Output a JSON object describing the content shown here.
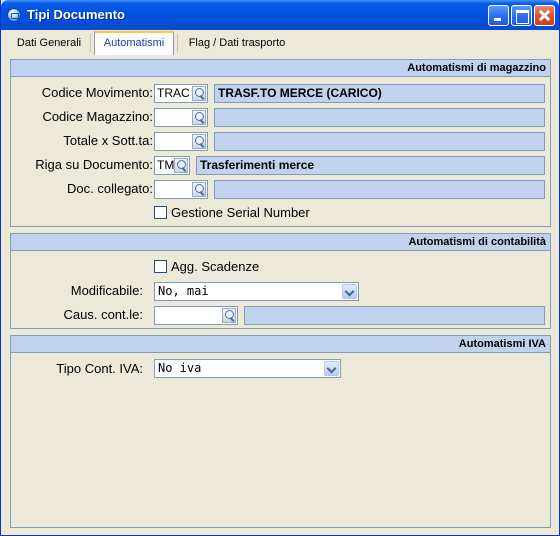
{
  "window": {
    "title": "Tipi Documento"
  },
  "tabs": [
    {
      "label": "Dati Generali"
    },
    {
      "label": "Automatismi"
    },
    {
      "label": "Flag / Dati trasporto"
    }
  ],
  "magazzino": {
    "header": "Automatismi di magazzino",
    "codice_movimento": {
      "label": "Codice Movimento:",
      "code": "TRAC",
      "desc": "TRASF.TO MERCE (CARICO)"
    },
    "codice_magazzino": {
      "label": "Codice Magazzino:",
      "code": "",
      "desc": ""
    },
    "totale_sott": {
      "label": "Totale x Sott.ta:",
      "code": "",
      "desc": ""
    },
    "riga_documento": {
      "label": "Riga su Documento:",
      "code": "TM",
      "desc": "Trasferimenti merce"
    },
    "doc_collegato": {
      "label": "Doc. collegato:",
      "code": "",
      "desc": ""
    },
    "gestione_serial": {
      "label": "Gestione Serial Number",
      "checked": false
    }
  },
  "contabilita": {
    "header": "Automatismi di contabilità",
    "agg_scadenze": {
      "label": "Agg. Scadenze",
      "checked": false
    },
    "modificabile": {
      "label": "Modificabile:",
      "value": "No, mai"
    },
    "caus_contle": {
      "label": "Caus. cont.le:",
      "code": "",
      "desc": ""
    }
  },
  "iva": {
    "header": "Automatismi IVA",
    "tipo_cont_iva": {
      "label": "Tipo Cont. IVA:",
      "value": "No iva"
    }
  },
  "icons": {
    "app": "window-app-icon",
    "lookup": "magnifier-icon",
    "dropdown": "chevron-down-icon"
  },
  "colors": {
    "titlebar": "#0053e1",
    "group_header": "#c1d2ee",
    "desc_field": "#c1d2ee",
    "window_bg": "#ece9d8"
  }
}
